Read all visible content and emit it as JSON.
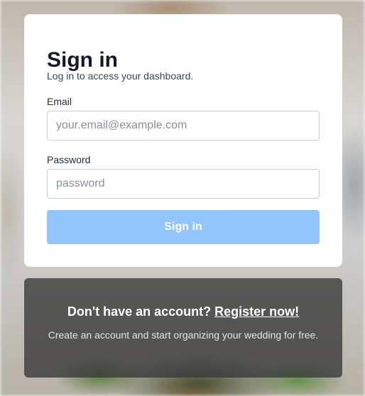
{
  "signin": {
    "title": "Sign in",
    "subtitle": "Log in to access your dashboard.",
    "email_label": "Email",
    "email_placeholder": "your.email@example.com",
    "password_label": "Password",
    "password_placeholder": "password",
    "button_label": "Sign in",
    "button_color": "#93c4fb"
  },
  "register": {
    "prompt": "Don't have an account?",
    "link_label": "Register now!",
    "description": "Create an account and start organizing your wedding for free."
  }
}
